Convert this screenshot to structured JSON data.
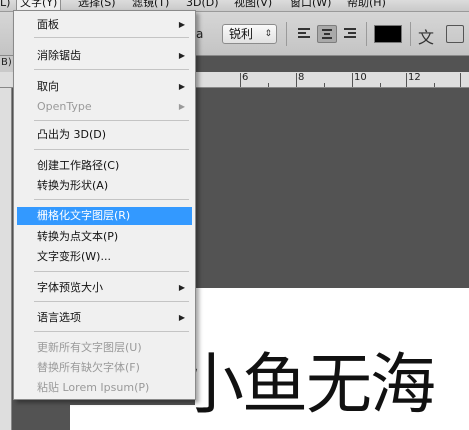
{
  "menubar": {
    "items": [
      "文字(Y)",
      "选择(S)",
      "滤镜(T)",
      "3D(D)",
      "视图(V)",
      "窗口(W)",
      "帮助(H)"
    ],
    "partial_left": "L)"
  },
  "toolbar": {
    "aa_label": "a",
    "antialias": "锐利",
    "antialias_arrows": "⇕",
    "text_color": "#000000"
  },
  "doc": {
    "tab_label": "B)"
  },
  "ruler": {
    "labels": [
      "6",
      "8",
      "10",
      "12"
    ]
  },
  "menu": {
    "items": [
      {
        "label": "面板",
        "submenu": true,
        "enabled": true
      },
      {
        "label": "消除锯齿",
        "submenu": true,
        "enabled": true
      },
      {
        "label": "取向",
        "submenu": true,
        "enabled": true
      },
      {
        "label": "OpenType",
        "submenu": true,
        "enabled": false
      },
      {
        "label": "凸出为 3D(D)",
        "submenu": false,
        "enabled": true
      },
      {
        "label": "创建工作路径(C)",
        "submenu": false,
        "enabled": true
      },
      {
        "label": "转换为形状(A)",
        "submenu": false,
        "enabled": true
      },
      {
        "label": "栅格化文字图层(R)",
        "submenu": false,
        "enabled": true,
        "highlighted": true
      },
      {
        "label": "转换为点文本(P)",
        "submenu": false,
        "enabled": true
      },
      {
        "label": "文字变形(W)...",
        "submenu": false,
        "enabled": true
      },
      {
        "label": "字体预览大小",
        "submenu": true,
        "enabled": true
      },
      {
        "label": "语言选项",
        "submenu": true,
        "enabled": true
      },
      {
        "label": "更新所有文字图层(U)",
        "submenu": false,
        "enabled": false
      },
      {
        "label": "替换所有缺欠字体(F)",
        "submenu": false,
        "enabled": false
      },
      {
        "label": "粘贴 Lorem Ipsum(P)",
        "submenu": false,
        "enabled": false
      }
    ],
    "arrow_glyph": "▶"
  },
  "canvas": {
    "text": "小鱼无海"
  }
}
